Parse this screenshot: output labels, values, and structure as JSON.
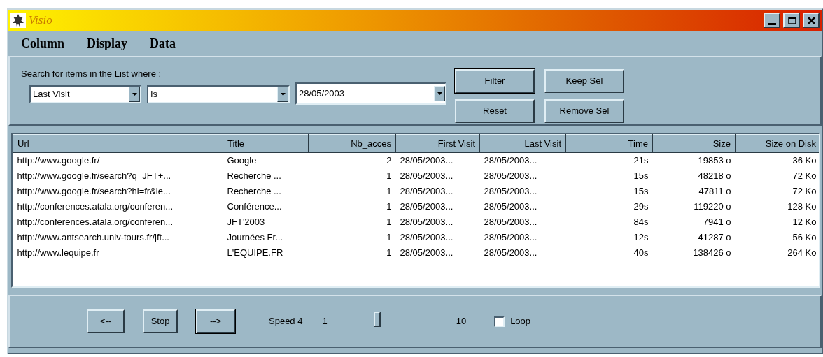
{
  "window": {
    "title": "Visio"
  },
  "menu": [
    "Column",
    "Display",
    "Data"
  ],
  "filter": {
    "label": "Search for items in the List where :",
    "field": "Last Visit",
    "operator": "Is",
    "value": "28/05/2003",
    "buttons": [
      {
        "label": "Filter",
        "default": true
      },
      {
        "label": "Keep Sel",
        "default": false
      },
      {
        "label": "Reset",
        "default": false
      },
      {
        "label": "Remove Sel",
        "default": false
      }
    ]
  },
  "table": {
    "columns": [
      "Url",
      "Title",
      "Nb_acces",
      "First Visit",
      "Last Visit",
      "Time",
      "Size",
      "Size on Disk"
    ],
    "rows": [
      [
        "http://www.google.fr/",
        "Google",
        "2",
        "28/05/2003...",
        "28/05/2003...",
        "21s",
        "19853 o",
        "36 Ko"
      ],
      [
        "http://www.google.fr/search?q=JFT+...",
        "Recherche ...",
        "1",
        "28/05/2003...",
        "28/05/2003...",
        "15s",
        "48218 o",
        "72 Ko"
      ],
      [
        "http://www.google.fr/search?hl=fr&ie...",
        "Recherche ...",
        "1",
        "28/05/2003...",
        "28/05/2003...",
        "15s",
        "47811 o",
        "72 Ko"
      ],
      [
        "http://conferences.atala.org/conferen...",
        "Conférence...",
        "1",
        "28/05/2003...",
        "28/05/2003...",
        "29s",
        "119220 o",
        "128 Ko"
      ],
      [
        "http://conferences.atala.org/conferen...",
        "JFT'2003",
        "1",
        "28/05/2003...",
        "28/05/2003...",
        "84s",
        "7941 o",
        "12 Ko"
      ],
      [
        "http://www.antsearch.univ-tours.fr/jft...",
        "Journées Fr...",
        "1",
        "28/05/2003...",
        "28/05/2003...",
        "12s",
        "41287 o",
        "56 Ko"
      ],
      [
        "http://www.lequipe.fr",
        "L'EQUIPE.FR",
        "1",
        "28/05/2003...",
        "28/05/2003...",
        "40s",
        "138426 o",
        "264 Ko"
      ]
    ]
  },
  "playback": {
    "buttons": [
      {
        "label": "<--",
        "default": false
      },
      {
        "label": "Stop",
        "default": false
      },
      {
        "label": "-->",
        "default": true
      }
    ],
    "speed_label": "Speed 4",
    "min": "1",
    "max": "10",
    "speed": {
      "level": 0.33
    },
    "loop": {
      "label": "Loop",
      "checked": false
    }
  }
}
